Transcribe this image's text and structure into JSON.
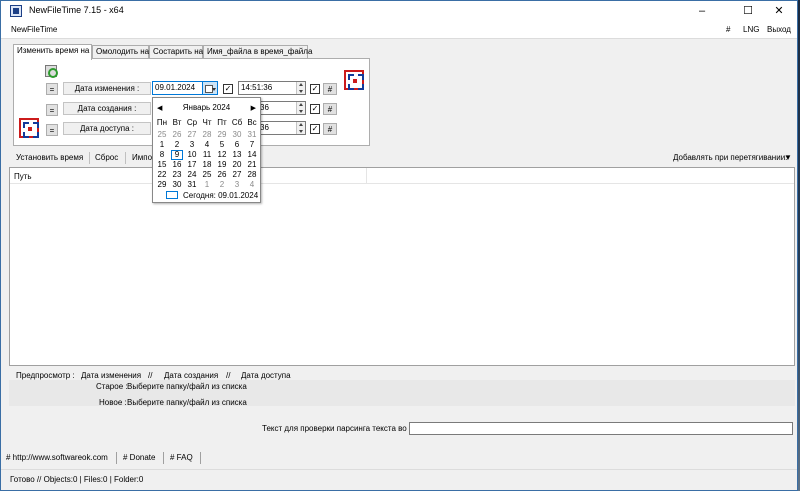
{
  "window": {
    "title": "NewFileTime 7.15 - x64",
    "minimize": "–",
    "maximize": "☐",
    "close": "✕"
  },
  "menu": {
    "app": "NewFileTime",
    "hash": "#",
    "lng": "LNG",
    "exit": "Выход"
  },
  "tabs": [
    "Изменить время на",
    "Омолодить на",
    "Состарить на",
    "Имя_файла в время_файла"
  ],
  "dates": {
    "eq_label": "=",
    "hash_label": "#",
    "modified": {
      "label": "Дата изменения :",
      "date": "09.01.2024",
      "time": "14:51:36",
      "checked": "✓"
    },
    "created": {
      "label": "Дата создания :",
      "time_partial": "36",
      "checked": "✓"
    },
    "accessed": {
      "label": "Дата доступа :",
      "time_partial": "36",
      "checked": "✓"
    }
  },
  "toolbar": {
    "set_time": "Установить время",
    "reset": "Сброс",
    "import": "Импо",
    "drop_option": "Добавлять при перетягивании:"
  },
  "list": {
    "path_header": "Путь"
  },
  "preview": {
    "label": "Предпросмотр :",
    "modified": "Дата изменения",
    "sep1": "//",
    "created": "Дата создания",
    "sep2": "//",
    "accessed": "Дата доступа",
    "old_label": "Старое :",
    "old_value": "Выберите папку/файл из списка",
    "new_label": "Новое :",
    "new_value": "Выберите папку/файл из списка",
    "parse_label": "Текст для проверки парсинга текста во время"
  },
  "links": {
    "site": "# http://www.softwareok.com",
    "donate": "# Donate",
    "faq": "# FAQ"
  },
  "status": {
    "text": "Готово // Objects:0 | Files:0 | Folder:0"
  },
  "calendar": {
    "prev": "◀",
    "next": "▶",
    "month": "Январь 2024",
    "weekdays": [
      "Пн",
      "Вт",
      "Ср",
      "Чт",
      "Пт",
      "Сб",
      "Вс"
    ],
    "weeks": [
      [
        "25",
        "26",
        "27",
        "28",
        "29",
        "30",
        "31"
      ],
      [
        "1",
        "2",
        "3",
        "4",
        "5",
        "6",
        "7"
      ],
      [
        "8",
        "9",
        "10",
        "11",
        "12",
        "13",
        "14"
      ],
      [
        "15",
        "16",
        "17",
        "18",
        "19",
        "20",
        "21"
      ],
      [
        "22",
        "23",
        "24",
        "25",
        "26",
        "27",
        "28"
      ],
      [
        "29",
        "30",
        "31",
        "1",
        "2",
        "3",
        "4"
      ]
    ],
    "today": "Сегодня: 09.01.2024"
  }
}
